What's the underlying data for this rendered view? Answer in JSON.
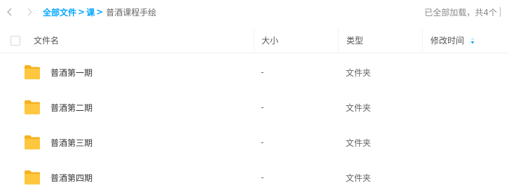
{
  "breadcrumb": {
    "root": "全部文件",
    "separator": ">",
    "middle": "课",
    "current": "普酒课程手绘"
  },
  "status": {
    "text": "已全部加载，共4个"
  },
  "table": {
    "columns": {
      "name": "文件名",
      "size": "大小",
      "type": "类型",
      "mtime": "修改时间"
    },
    "sort": {
      "column": "mtime",
      "icon": "sort-arrow-icon"
    },
    "rows": [
      {
        "name": "普酒第一期",
        "size": "-",
        "type": "文件夹",
        "icon": "folder-icon"
      },
      {
        "name": "普酒第二期",
        "size": "-",
        "type": "文件夹",
        "icon": "folder-icon"
      },
      {
        "name": "普酒第三期",
        "size": "-",
        "type": "文件夹",
        "icon": "folder-icon"
      },
      {
        "name": "普酒第四期",
        "size": "-",
        "type": "文件夹",
        "icon": "folder-icon"
      }
    ]
  },
  "colors": {
    "accent": "#06a7ff",
    "folder": "#ffc740",
    "folder_back": "#f5b11f"
  }
}
